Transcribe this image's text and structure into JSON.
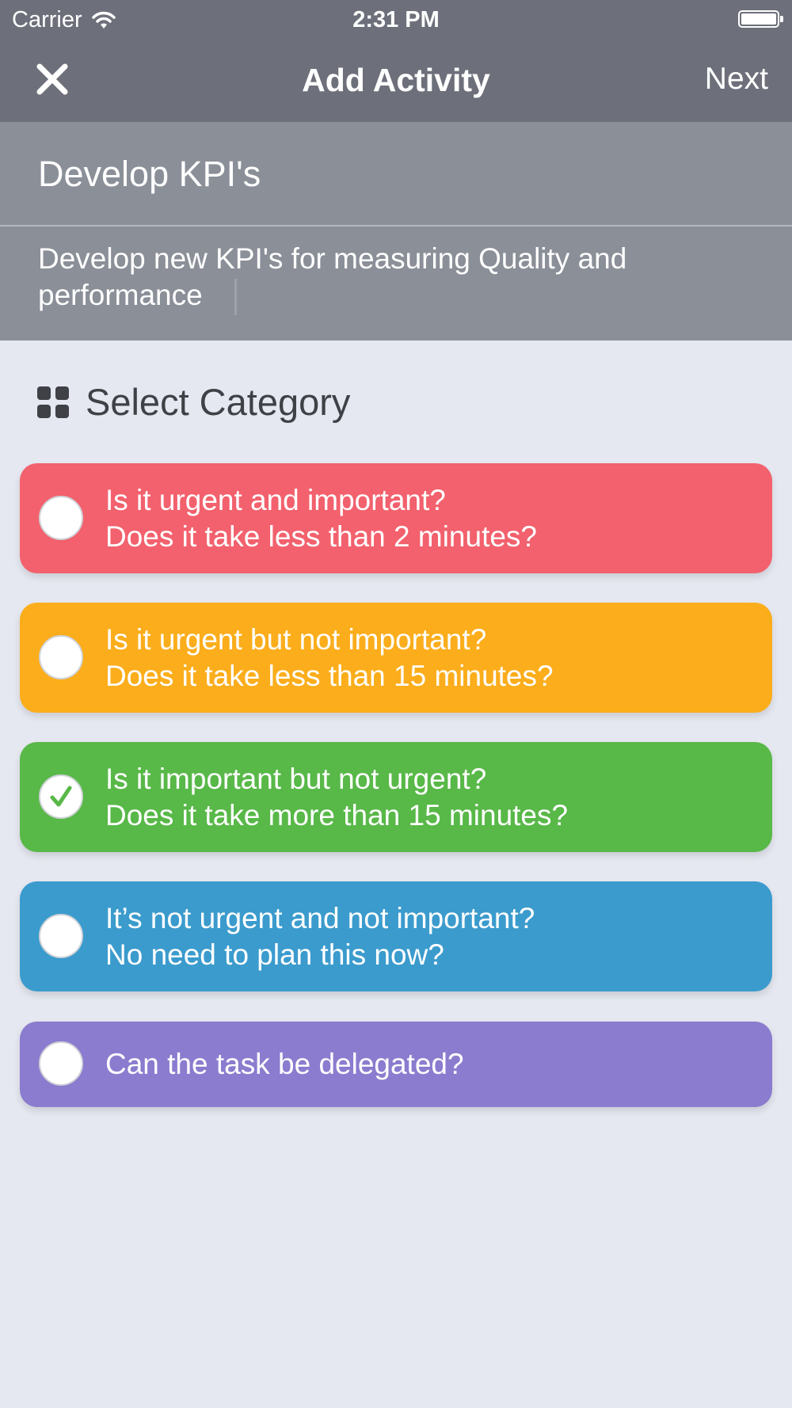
{
  "status_bar": {
    "carrier": "Carrier",
    "time": "2:31 PM"
  },
  "nav": {
    "title": "Add Activity",
    "next_label": "Next"
  },
  "activity": {
    "title": "Develop KPI's",
    "description": "Develop new KPI's for measuring Quality and performance"
  },
  "section": {
    "label": "Select Category"
  },
  "categories": [
    {
      "line1": "Is it urgent and important?",
      "line2": "Does it take less than 2 minutes?",
      "color": "#f2616d",
      "selected": false
    },
    {
      "line1": "Is it urgent but not important?",
      "line2": "Does it take less than 15 minutes?",
      "color": "#fbad1b",
      "selected": false
    },
    {
      "line1": "Is it important but not urgent?",
      "line2": "Does it take more than 15 minutes?",
      "color": "#58b848",
      "selected": true
    },
    {
      "line1": "It’s not urgent and not important?",
      "line2": "No need to plan this now?",
      "color": "#3b9bcd",
      "selected": false
    },
    {
      "line1": "Can the task be delegated?",
      "line2": "",
      "color": "#8b7ccf",
      "selected": false
    }
  ]
}
